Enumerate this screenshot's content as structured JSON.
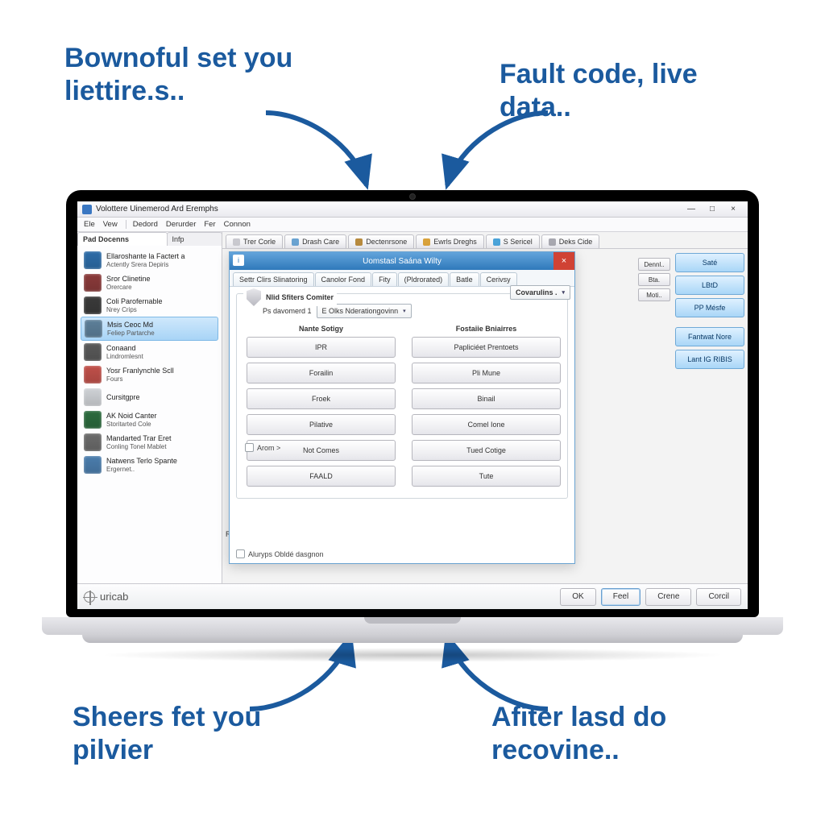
{
  "callouts": {
    "tl": "Bownoful set you liettire.s..",
    "tr": "Fault code, live data..",
    "bl": "Sheers fet you pilvier",
    "br": "Afiter lasd do recovine.."
  },
  "window": {
    "title": "Volottere Uinemerod Ard Eremphs",
    "win_controls": {
      "min": "—",
      "max": "□",
      "close": "×"
    },
    "menubar": [
      "Ele",
      "Vew",
      "Dedord",
      "Derurder",
      "Fer",
      "Connon"
    ]
  },
  "sidebar": {
    "tabs": [
      "Pad Docenns",
      "Infp"
    ],
    "items": [
      {
        "line1": "Ellaroshante la Factert a",
        "line2": "Actently Srera Depiris",
        "icon_color": "#2d6ca8"
      },
      {
        "line1": "Sror Clinetine",
        "line2": "Orercare",
        "icon_color": "#8a3a3a"
      },
      {
        "line1": "Coli Parofernable",
        "line2": "Nrey Crips",
        "icon_color": "#3a3a3a"
      },
      {
        "line1": "Msis Ceoc Md",
        "line2": "Feliep Partarche",
        "icon_color": "#5d7f99",
        "selected": true
      },
      {
        "line1": "Conaand",
        "line2": "Lindromlesnt",
        "icon_color": "#595959"
      },
      {
        "line1": "Yosr Franlynchle Scll",
        "line2": "Fours",
        "icon_color": "#c0504a"
      },
      {
        "line1": "Cursitgpre",
        "line2": "",
        "icon_color": "#cfd2d6"
      },
      {
        "line1": "AK Noid Canter",
        "line2": "Storitarted Cole",
        "icon_color": "#2c6b3e"
      },
      {
        "line1": "Mandarted Trar Eret",
        "line2": "Conling Tonel Mablet",
        "icon_color": "#6b6b6b"
      },
      {
        "line1": "Natwens Terlo Spante",
        "line2": "Ergernet..",
        "icon_color": "#4b7dad"
      }
    ]
  },
  "main_tabs": [
    {
      "label": "Trer Corle",
      "dot": "#c9c9cf"
    },
    {
      "label": "Drash Care",
      "dot": "#6aa3d1"
    },
    {
      "label": "Dectenrsone",
      "dot": "#b78a3e"
    },
    {
      "label": "Ewrls Dreghs",
      "dot": "#d9a23b"
    },
    {
      "label": "S Sericel",
      "dot": "#4aa3d9"
    },
    {
      "label": "Deks Cide",
      "dot": "#a8a8b0"
    }
  ],
  "aux_buttons": [
    "Dennl..",
    "Bta.",
    "Moti.."
  ],
  "right_buttons_top": [
    "Saté",
    "LBtD",
    "PP Mésfe"
  ],
  "right_buttons_low": [
    "Fantwat Nore",
    "Lant IG RIBIS"
  ],
  "dialog": {
    "title": "Uomstasl Saána Wilty",
    "title_icon": "i",
    "close": "×",
    "tabs": [
      "Settr Clirs Slinatoring",
      "Canolor Fond",
      "Fity",
      "(Pldrorated)",
      "Batle",
      "Cerivsy"
    ],
    "group_title": "Nlid Sfiters Comiter",
    "top_label": "Ps davomerd  1",
    "top_combo_value": "E Olks Nderationgovinn",
    "right_combo": "Covarulins .",
    "side_check_label": "Arom  >",
    "columns": {
      "left_header": "Nante Sotigy",
      "right_header": "Fostaiie Bniairres",
      "left": [
        "IPR",
        "Forailin",
        "Froek",
        "Pilative",
        "Not Comes",
        "FAALD"
      ],
      "right": [
        "Papliciéet Prentoets",
        "Pli Mune",
        "Binail",
        "Comel Ione",
        "Tued Cotige",
        "Tute"
      ]
    },
    "footer_check": "Aluryps Obldé dasgnon"
  },
  "side_panel_label": "Rare",
  "footer": {
    "brand": "uricab",
    "buttons": [
      "OK",
      "Feel",
      "Crene",
      "Corcil"
    ]
  }
}
